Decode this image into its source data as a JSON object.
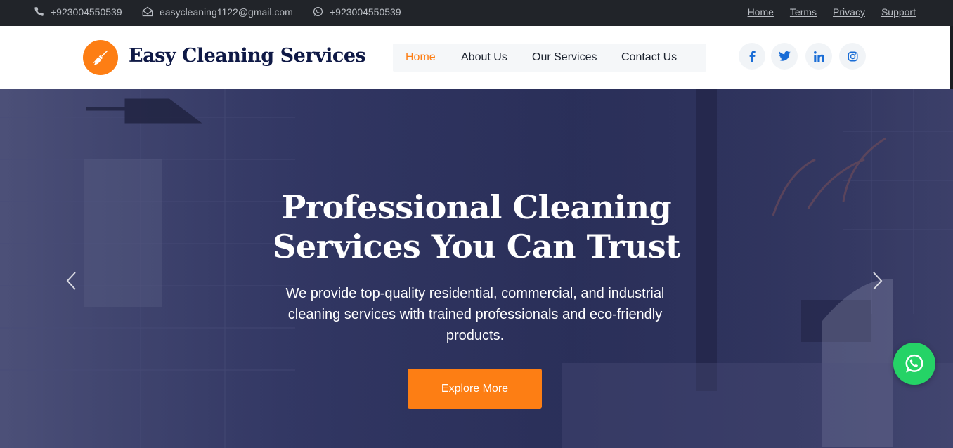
{
  "topbar": {
    "phone": "+923004550539",
    "email": "easycleaning1122@gmail.com",
    "whatsapp": "+923004550539",
    "links": [
      "Home",
      "Terms",
      "Privacy",
      "Support"
    ]
  },
  "header": {
    "brand": "Easy Cleaning Services",
    "nav": [
      "Home",
      "About Us",
      "Our Services",
      "Contact Us"
    ],
    "active_nav": "Home",
    "social_icons": [
      "facebook-icon",
      "twitter-icon",
      "linkedin-icon",
      "instagram-icon"
    ]
  },
  "hero": {
    "title_line1": "Professional Cleaning",
    "title_line2": "Services You Can Trust",
    "subtitle": "We provide top-quality residential, commercial, and industrial cleaning services with trained professionals and eco-friendly products.",
    "button_label": "Explore More"
  },
  "colors": {
    "accent": "#fd7e14",
    "brand_text": "#0f1946",
    "topbar_bg": "#212429",
    "whatsapp": "#25d366",
    "hero_overlay": "#2f3460",
    "social_icon": "#1a6dd6"
  }
}
